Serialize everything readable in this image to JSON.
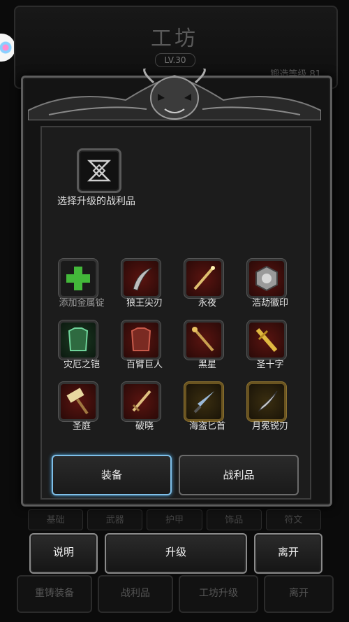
{
  "background": {
    "title": "工坊",
    "level": "LV.30",
    "forge_level": "锻造等级 81",
    "tabs": [
      "基础",
      "武器",
      "护甲",
      "饰品",
      "符文"
    ],
    "bottom_buttons": [
      "重铸装备",
      "战利品",
      "工坊升级",
      "离开"
    ]
  },
  "panel": {
    "select_label": "选择升级的战利品",
    "items": [
      {
        "name": "添加金属锭",
        "icon": "green-plus-icon",
        "dim": true
      },
      {
        "name": "狼王尖刃",
        "icon": "claw-blade-icon"
      },
      {
        "name": "永夜",
        "icon": "golden-wand-icon"
      },
      {
        "name": "浩劫徽印",
        "icon": "emblem-icon"
      },
      {
        "name": "灾厄之铠",
        "icon": "green-armor-icon"
      },
      {
        "name": "百臂巨人",
        "icon": "red-armor-icon"
      },
      {
        "name": "黑星",
        "icon": "staff-icon"
      },
      {
        "name": "圣十字",
        "icon": "golden-sword-icon"
      },
      {
        "name": "圣庭",
        "icon": "hammer-icon"
      },
      {
        "name": "破晓",
        "icon": "sword-icon"
      },
      {
        "name": "海盗匕首",
        "icon": "dagger-icon"
      },
      {
        "name": "月冕锐刃",
        "icon": "dark-blade-icon"
      }
    ],
    "tabs": {
      "equipment": "装备",
      "loot": "战利品"
    }
  },
  "actions": {
    "help": "说明",
    "upgrade": "升级",
    "leave": "离开"
  },
  "colors": {
    "active_tab_border": "#7fbfe8",
    "slot_red": "#8a1e1a",
    "slot_gold": "#8a6a1a"
  }
}
